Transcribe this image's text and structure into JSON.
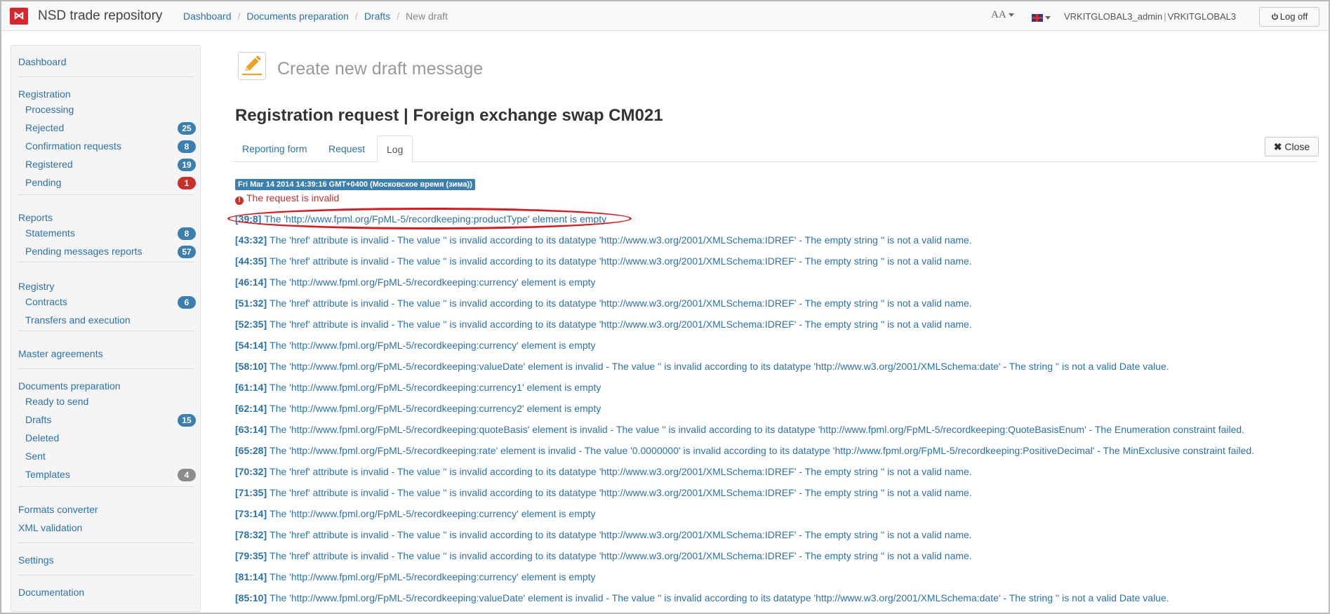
{
  "navbar": {
    "logo_glyph": "⋈",
    "brand": "NSD trade repository",
    "breadcrumbs": [
      "Dashboard",
      "Documents preparation",
      "Drafts"
    ],
    "breadcrumb_current": "New draft",
    "font_label": "AA",
    "user_name": "VRKITGLOBAL3_admin",
    "user_org": "VRKITGLOBAL3",
    "logoff_label": "Log off"
  },
  "sidebar": {
    "dashboard": "Dashboard",
    "registration": {
      "title": "Registration",
      "items": [
        {
          "label": "Processing",
          "badge": ""
        },
        {
          "label": "Rejected",
          "badge": "25"
        },
        {
          "label": "Confirmation requests",
          "badge": "8"
        },
        {
          "label": "Registered",
          "badge": "19"
        },
        {
          "label": "Pending",
          "badge": "1"
        }
      ]
    },
    "reports": {
      "title": "Reports",
      "items": [
        {
          "label": "Statements",
          "badge": "8"
        },
        {
          "label": "Pending messages reports",
          "badge": "57"
        }
      ]
    },
    "registry": {
      "title": "Registry",
      "items": [
        {
          "label": "Contracts",
          "badge": "6"
        },
        {
          "label": "Transfers and execution",
          "badge": ""
        }
      ]
    },
    "master_agreements": "Master agreements",
    "documents": {
      "title": "Documents preparation",
      "items": [
        {
          "label": "Ready to send",
          "badge": ""
        },
        {
          "label": "Drafts",
          "badge": "15"
        },
        {
          "label": "Deleted",
          "badge": ""
        },
        {
          "label": "Sent",
          "badge": ""
        },
        {
          "label": "Templates",
          "badge": "4"
        }
      ]
    },
    "formats_converter": "Formats converter",
    "xml_validation": "XML validation",
    "settings": "Settings",
    "documentation": "Documentation"
  },
  "main": {
    "page_title": "Create new draft message",
    "heading": "Registration request | Foreign exchange swap CM021",
    "tabs": [
      "Reporting form",
      "Request",
      "Log"
    ],
    "active_tab": "Log",
    "close_label": "Close",
    "timestamp": "Fri Mar 14 2014 14:39:16 GMT+0400 (Московское время (зима))",
    "invalid_message": "The request is invalid",
    "log_entries": [
      {
        "code": "[39:8]",
        "text": "The 'http://www.fpml.org/FpML-5/recordkeeping:productType' element is empty"
      },
      {
        "code": "[43:32]",
        "text": "The 'href' attribute is invalid - The value '' is invalid according to its datatype 'http://www.w3.org/2001/XMLSchema:IDREF' - The empty string '' is not a valid name."
      },
      {
        "code": "[44:35]",
        "text": "The 'href' attribute is invalid - The value '' is invalid according to its datatype 'http://www.w3.org/2001/XMLSchema:IDREF' - The empty string '' is not a valid name."
      },
      {
        "code": "[46:14]",
        "text": "The 'http://www.fpml.org/FpML-5/recordkeeping:currency' element is empty"
      },
      {
        "code": "[51:32]",
        "text": "The 'href' attribute is invalid - The value '' is invalid according to its datatype 'http://www.w3.org/2001/XMLSchema:IDREF' - The empty string '' is not a valid name."
      },
      {
        "code": "[52:35]",
        "text": "The 'href' attribute is invalid - The value '' is invalid according to its datatype 'http://www.w3.org/2001/XMLSchema:IDREF' - The empty string '' is not a valid name."
      },
      {
        "code": "[54:14]",
        "text": "The 'http://www.fpml.org/FpML-5/recordkeeping:currency' element is empty"
      },
      {
        "code": "[58:10]",
        "text": "The 'http://www.fpml.org/FpML-5/recordkeeping:valueDate' element is invalid - The value '' is invalid according to its datatype 'http://www.w3.org/2001/XMLSchema:date' - The string '' is not a valid Date value."
      },
      {
        "code": "[61:14]",
        "text": "The 'http://www.fpml.org/FpML-5/recordkeeping:currency1' element is empty"
      },
      {
        "code": "[62:14]",
        "text": "The 'http://www.fpml.org/FpML-5/recordkeeping:currency2' element is empty"
      },
      {
        "code": "[63:14]",
        "text": "The 'http://www.fpml.org/FpML-5/recordkeeping:quoteBasis' element is invalid - The value '' is invalid according to its datatype 'http://www.fpml.org/FpML-5/recordkeeping:QuoteBasisEnum' - The Enumeration constraint failed."
      },
      {
        "code": "[65:28]",
        "text": "The 'http://www.fpml.org/FpML-5/recordkeeping:rate' element is invalid - The value '0.0000000' is invalid according to its datatype 'http://www.fpml.org/FpML-5/recordkeeping:PositiveDecimal' - The MinExclusive constraint failed."
      },
      {
        "code": "[70:32]",
        "text": "The 'href' attribute is invalid - The value '' is invalid according to its datatype 'http://www.w3.org/2001/XMLSchema:IDREF' - The empty string '' is not a valid name."
      },
      {
        "code": "[71:35]",
        "text": "The 'href' attribute is invalid - The value '' is invalid according to its datatype 'http://www.w3.org/2001/XMLSchema:IDREF' - The empty string '' is not a valid name."
      },
      {
        "code": "[73:14]",
        "text": "The 'http://www.fpml.org/FpML-5/recordkeeping:currency' element is empty"
      },
      {
        "code": "[78:32]",
        "text": "The 'href' attribute is invalid - The value '' is invalid according to its datatype 'http://www.w3.org/2001/XMLSchema:IDREF' - The empty string '' is not a valid name."
      },
      {
        "code": "[79:35]",
        "text": "The 'href' attribute is invalid - The value '' is invalid according to its datatype 'http://www.w3.org/2001/XMLSchema:IDREF' - The empty string '' is not a valid name."
      },
      {
        "code": "[81:14]",
        "text": "The 'http://www.fpml.org/FpML-5/recordkeeping:currency' element is empty"
      },
      {
        "code": "[85:10]",
        "text": "The 'http://www.fpml.org/FpML-5/recordkeeping:valueDate' element is invalid - The value '' is invalid according to its datatype 'http://www.w3.org/2001/XMLSchema:date' - The string '' is not a valid Date value."
      }
    ]
  },
  "icons": {
    "logo": "nsd-logo-icon",
    "font_size": "font-size-icon",
    "language": "uk-flag-icon",
    "logoff": "power-icon",
    "page": "pencil-icon",
    "close": "x-icon",
    "error": "exclamation-icon"
  },
  "colors": {
    "brand_red": "#d9252c",
    "link_blue": "#2a72ad",
    "badge_blue": "#3b7fae",
    "badge_red": "#c9302c",
    "badge_gray": "#8c8c8c",
    "error_red": "#c9302c",
    "highlight_ring": "#e3141b"
  }
}
